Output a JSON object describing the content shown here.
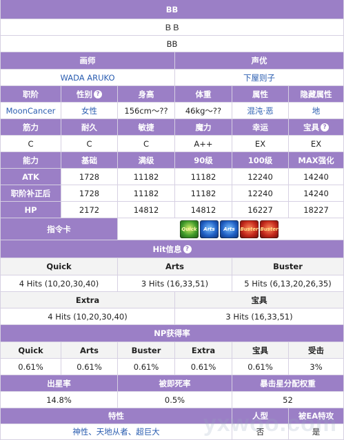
{
  "name_header": "BB",
  "name_jp": "ＢＢ",
  "name_en": "BB",
  "illustrator_header": "画师",
  "voice_header": "声优",
  "illustrator": "WADA ARUKO",
  "voice_actor": "下屋则子",
  "profile_headers": [
    "职阶",
    "性别",
    "身高",
    "体重",
    "属性",
    "隐藏属性"
  ],
  "profile_values": [
    "MoonCancer",
    "女性",
    "156cm～??",
    "46kg～??",
    "混沌·恶",
    "地"
  ],
  "param_headers": [
    "筋力",
    "耐久",
    "敏捷",
    "魔力",
    "幸运",
    "宝具"
  ],
  "param_values": [
    "C",
    "C",
    "C",
    "A++",
    "EX",
    "EX"
  ],
  "ability_headers": [
    "能力",
    "基础",
    "满级",
    "90级",
    "100级",
    "MAX强化"
  ],
  "ability_rows": [
    {
      "label": "ATK",
      "values": [
        "1728",
        "11182",
        "11182",
        "12240",
        "14240"
      ]
    },
    {
      "label": "职阶补正后",
      "values": [
        "1728",
        "11182",
        "11182",
        "12240",
        "14240"
      ]
    },
    {
      "label": "HP",
      "values": [
        "2172",
        "14812",
        "14812",
        "16227",
        "18227"
      ]
    }
  ],
  "cards_header": "指令卡",
  "cards": [
    {
      "type": "quick",
      "label": "Quick"
    },
    {
      "type": "arts",
      "label": "Arts"
    },
    {
      "type": "arts",
      "label": "Arts"
    },
    {
      "type": "buster",
      "label": "Buster"
    },
    {
      "type": "buster",
      "label": "Buster"
    }
  ],
  "hit_header": "Hit信息",
  "hit_headers": [
    "Quick",
    "Arts",
    "Buster"
  ],
  "hit_values": [
    "4 Hits (10,20,30,40)",
    "3 Hits (16,33,51)",
    "5 Hits (6,13,20,26,35)"
  ],
  "hit2_headers": [
    "Extra",
    "宝具"
  ],
  "hit2_values": [
    "4 Hits (10,20,30,40)",
    "3 Hits (16,33,51)"
  ],
  "np_header": "NP获得率",
  "np_headers": [
    "Quick",
    "Arts",
    "Buster",
    "Extra",
    "宝具",
    "受击"
  ],
  "np_values": [
    "0.61%",
    "0.61%",
    "0.61%",
    "0.61%",
    "0.61%",
    "3%"
  ],
  "star_headers": [
    "出星率",
    "被即死率",
    "暴击星分配权重"
  ],
  "star_values": [
    "14.8%",
    "0.5%",
    "52"
  ],
  "trait_headers": [
    "特性",
    "人型",
    "被EA特攻"
  ],
  "trait_values": [
    "神性、天地从者、超巨大",
    "否",
    "是"
  ],
  "help_icon_glyph": "?",
  "watermark": "yxwoo.com"
}
